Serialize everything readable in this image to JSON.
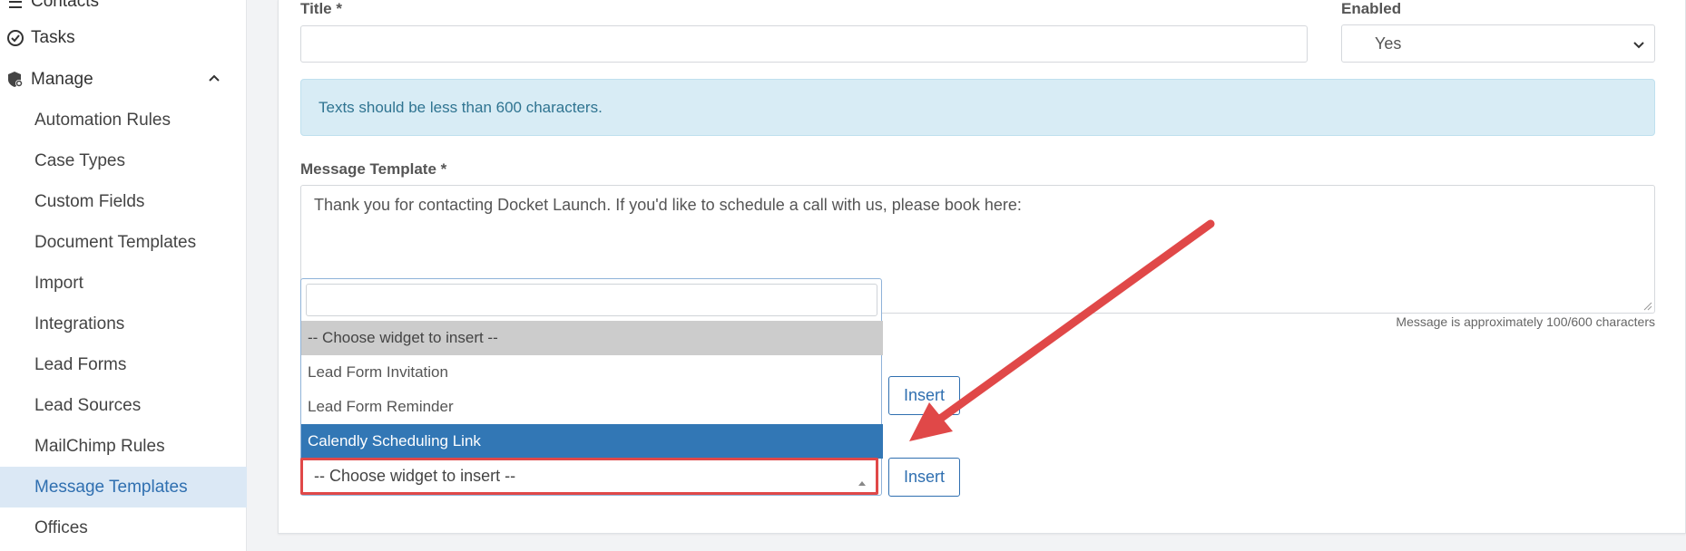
{
  "sidebar": {
    "top_items": [
      {
        "label": "Contacts",
        "icon": "contacts-icon"
      },
      {
        "label": "Tasks",
        "icon": "check-circle-icon"
      },
      {
        "label": "Manage",
        "icon": "shield-gear-icon"
      }
    ],
    "sub_items": [
      {
        "label": "Automation Rules"
      },
      {
        "label": "Case Types"
      },
      {
        "label": "Custom Fields"
      },
      {
        "label": "Document Templates"
      },
      {
        "label": "Import"
      },
      {
        "label": "Integrations"
      },
      {
        "label": "Lead Forms"
      },
      {
        "label": "Lead Sources"
      },
      {
        "label": "MailChimp Rules"
      },
      {
        "label": "Message Templates",
        "active": true
      },
      {
        "label": "Offices"
      }
    ]
  },
  "form": {
    "title_label": "Title *",
    "title_value": "",
    "enabled_label": "Enabled",
    "enabled_value": "Yes",
    "alert_text": "Texts should be less than 600 characters.",
    "message_label": "Message Template *",
    "message_value": "Thank you for contacting Docket Launch. If you'd like to schedule a call with us, please book here:",
    "counter_text": "Message is approximately 100/600 characters",
    "insert_label_1": "Insert",
    "insert_label_2": "Insert",
    "widget_select_value": "-- Choose widget to insert --"
  },
  "dropdown": {
    "search_value": "",
    "options": [
      {
        "label": "-- Choose widget to insert --",
        "state": "selected"
      },
      {
        "label": "Lead Form Invitation",
        "state": "normal"
      },
      {
        "label": "Lead Form Reminder",
        "state": "normal"
      },
      {
        "label": "Calendly Scheduling Link",
        "state": "highlighted"
      }
    ]
  },
  "colors": {
    "accent": "#2f6fb0",
    "highlight": "#3277b5",
    "annotation_red": "#e04848",
    "alert_bg": "#d8ecf5"
  }
}
